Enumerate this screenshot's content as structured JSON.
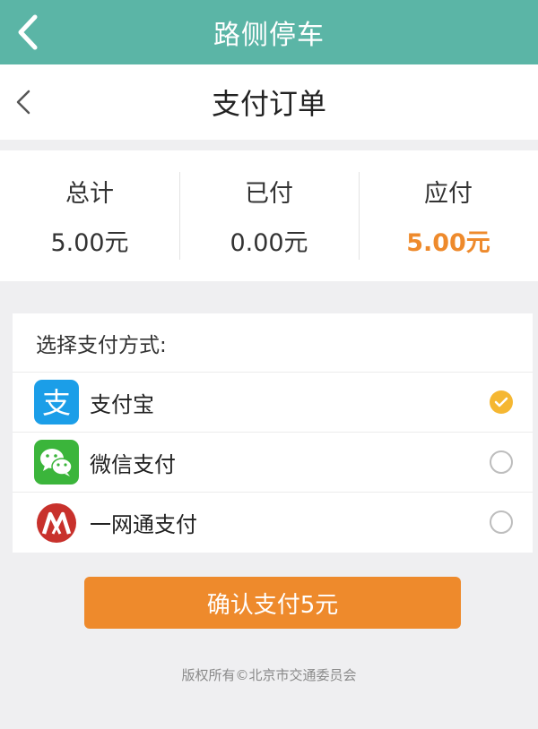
{
  "app_bar": {
    "title": "路侧停车",
    "back_icon": "chevron-left-icon"
  },
  "nav_bar": {
    "title": "支付订单",
    "back_icon": "chevron-left-icon"
  },
  "summary": {
    "total": {
      "label": "总计",
      "value": "5.00元"
    },
    "paid": {
      "label": "已付",
      "value": "0.00元"
    },
    "due": {
      "label": "应付",
      "value": "5.00元",
      "color": "#ee8a2c"
    }
  },
  "payment": {
    "heading": "选择支付方式:",
    "methods": [
      {
        "name": "支付宝",
        "icon": "alipay-icon",
        "selected": true
      },
      {
        "name": "微信支付",
        "icon": "wechat-pay-icon",
        "selected": false
      },
      {
        "name": "一网通支付",
        "icon": "yiwangtong-icon",
        "selected": false
      }
    ]
  },
  "confirm_button": {
    "label": "确认支付5元",
    "color": "#ee8a2c"
  },
  "footer": {
    "text": "版权所有©北京市交通委员会"
  },
  "colors": {
    "header": "#5bb5a6",
    "accent": "#ee8a2c",
    "check": "#f5b732"
  }
}
